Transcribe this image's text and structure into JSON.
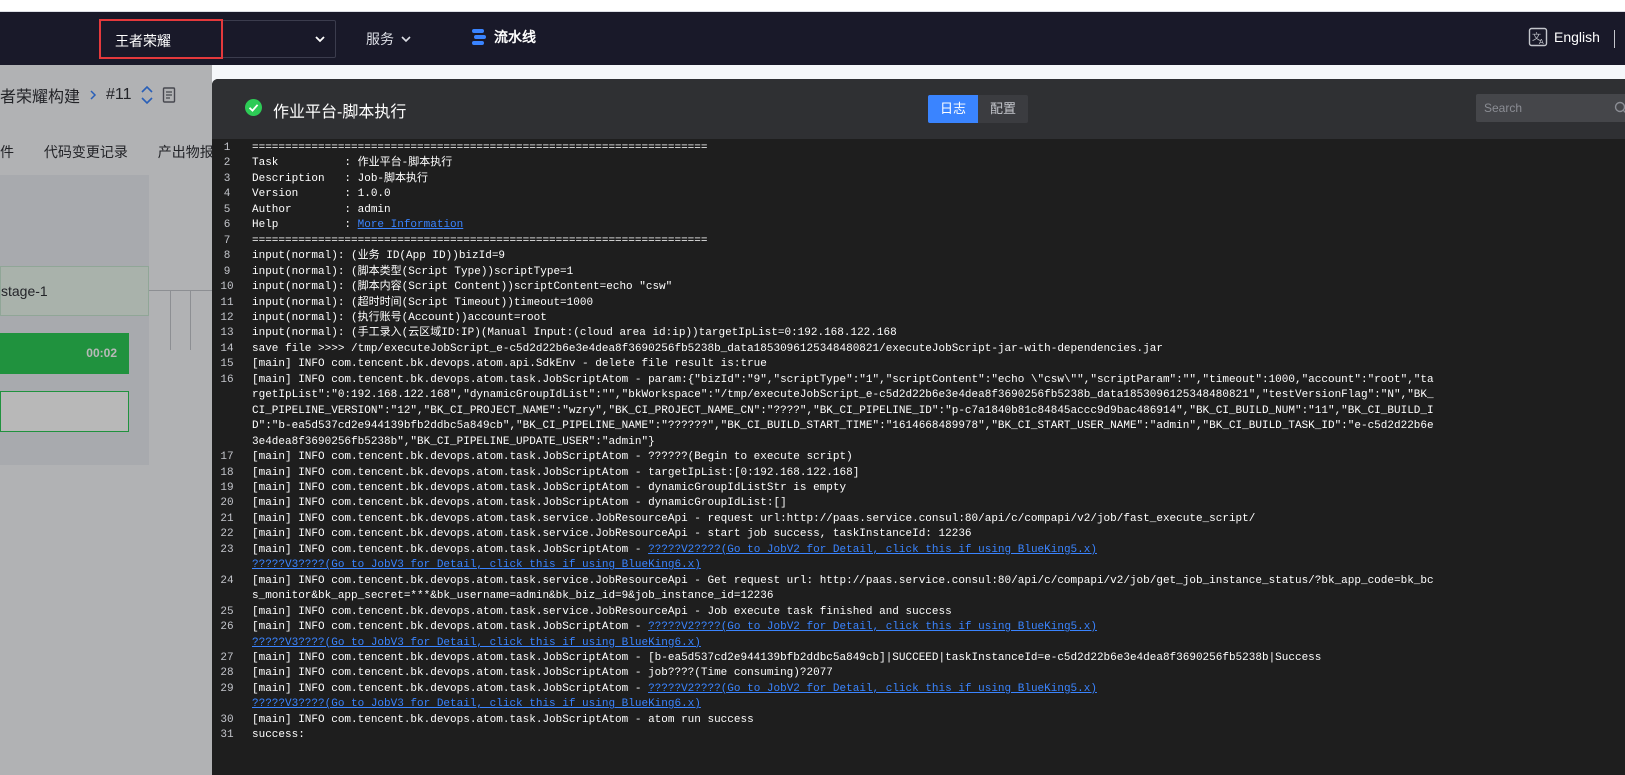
{
  "topnav": {
    "project_name": "王者荣耀",
    "service_label": "服务",
    "pipeline_label": "流水线",
    "language_label": "English"
  },
  "bg": {
    "breadcrumb_name": "者荣耀构建",
    "build_no": "#11",
    "tab_1": "件",
    "tab_2": "代码变更记录",
    "tab_3": "产出物报",
    "stage_label": "stage-1",
    "job_time": "00:02"
  },
  "panel": {
    "title": "作业平台-脚本执行",
    "tab_log": "日志",
    "tab_config": "配置",
    "search_placeholder": "Search",
    "status_color": "#2dcb56"
  },
  "log": [
    {
      "n": "1",
      "text": "====================================================================="
    },
    {
      "n": "2",
      "text": "Task          : 作业平台-脚本执行"
    },
    {
      "n": "3",
      "text": "Description   : Job-脚本执行"
    },
    {
      "n": "4",
      "text": "Version       : 1.0.0"
    },
    {
      "n": "5",
      "text": "Author        : admin"
    },
    {
      "n": "6",
      "text": "Help          : ",
      "link": "More Information"
    },
    {
      "n": "7",
      "text": "====================================================================="
    },
    {
      "n": "8",
      "text": "input(normal): (业务 ID(App ID))bizId=9"
    },
    {
      "n": "9",
      "text": "input(normal): (脚本类型(Script Type))scriptType=1"
    },
    {
      "n": "10",
      "text": "input(normal): (脚本内容(Script Content))scriptContent=echo \"csw\""
    },
    {
      "n": "11",
      "text": "input(normal): (超时时间(Script Timeout))timeout=1000"
    },
    {
      "n": "12",
      "text": "input(normal): (执行账号(Account))account=root"
    },
    {
      "n": "13",
      "text": "input(normal): (手工录入(云区域ID:IP)(Manual Input:(cloud area id:ip))targetIpList=0:192.168.122.168"
    },
    {
      "n": "14",
      "text": "save file >>>> /tmp/executeJobScript_e-c5d2d22b6e3e4dea8f3690256fb5238b_data1853096125348480821/executeJobScript-jar-with-dependencies.jar"
    },
    {
      "n": "15",
      "text": "[main] INFO com.tencent.bk.devops.atom.api.SdkEnv - delete file result is:true"
    },
    {
      "n": "16",
      "text": "[main] INFO com.tencent.bk.devops.atom.task.JobScriptAtom - param:{\"bizId\":\"9\",\"scriptType\":\"1\",\"scriptContent\":\"echo \\\"csw\\\"\",\"scriptParam\":\"\",\"timeout\":1000,\"account\":\"root\",\"targetIpList\":\"0:192.168.122.168\",\"dynamicGroupIdList\":\"\",\"bkWorkspace\":\"/tmp/executeJobScript_e-c5d2d22b6e3e4dea8f3690256fb5238b_data1853096125348480821\",\"testVersionFlag\":\"N\",\"BK_CI_PIPELINE_VERSION\":\"12\",\"BK_CI_PROJECT_NAME\":\"wzry\",\"BK_CI_PROJECT_NAME_CN\":\"????\",\"BK_CI_PIPELINE_ID\":\"p-c7a1840b81c84845accc9d9bac486914\",\"BK_CI_BUILD_NUM\":\"11\",\"BK_CI_BUILD_ID\":\"b-ea5d537cd2e944139bfb2ddbc5a849cb\",\"BK_CI_PIPELINE_NAME\":\"??????\",\"BK_CI_BUILD_START_TIME\":\"1614668489978\",\"BK_CI_START_USER_NAME\":\"admin\",\"BK_CI_BUILD_TASK_ID\":\"e-c5d2d22b6e3e4dea8f3690256fb5238b\",\"BK_CI_PIPELINE_UPDATE_USER\":\"admin\"}"
    },
    {
      "n": "17",
      "text": "[main] INFO com.tencent.bk.devops.atom.task.JobScriptAtom - ??????(Begin to execute script)"
    },
    {
      "n": "18",
      "text": "[main] INFO com.tencent.bk.devops.atom.task.JobScriptAtom - targetIpList:[0:192.168.122.168]"
    },
    {
      "n": "19",
      "text": "[main] INFO com.tencent.bk.devops.atom.task.JobScriptAtom - dynamicGroupIdListStr is empty"
    },
    {
      "n": "20",
      "text": "[main] INFO com.tencent.bk.devops.atom.task.JobScriptAtom - dynamicGroupIdList:[]"
    },
    {
      "n": "21",
      "text": "[main] INFO com.tencent.bk.devops.atom.task.service.JobResourceApi - request url:http://paas.service.consul:80/api/c/compapi/v2/job/fast_execute_script/"
    },
    {
      "n": "22",
      "text": "[main] INFO com.tencent.bk.devops.atom.task.service.JobResourceApi - start job success, taskInstanceId: 12236"
    },
    {
      "n": "23",
      "text": "[main] INFO com.tencent.bk.devops.atom.task.JobScriptAtom - ",
      "link": "?????V2????(Go to JobV2 for Detail, click this if using BlueKing5.x)",
      "link2": "?????V3????(Go to JobV3 for Detail, click this if using BlueKing6.x)"
    },
    {
      "n": "24",
      "text": "[main] INFO com.tencent.bk.devops.atom.task.service.JobResourceApi - Get request url: http://paas.service.consul:80/api/c/compapi/v2/job/get_job_instance_status/?bk_app_code=bk_bcs_monitor&bk_app_secret=***&bk_username=admin&bk_biz_id=9&job_instance_id=12236"
    },
    {
      "n": "25",
      "text": "[main] INFO com.tencent.bk.devops.atom.task.service.JobResourceApi - Job execute task finished and success"
    },
    {
      "n": "26",
      "text": "[main] INFO com.tencent.bk.devops.atom.task.JobScriptAtom - ",
      "link": "?????V2????(Go to JobV2 for Detail, click this if using BlueKing5.x)",
      "link2": "?????V3????(Go to JobV3 for Detail, click this if using BlueKing6.x)"
    },
    {
      "n": "27",
      "text": "[main] INFO com.tencent.bk.devops.atom.task.JobScriptAtom - [b-ea5d537cd2e944139bfb2ddbc5a849cb]|SUCCEED|taskInstanceId=e-c5d2d22b6e3e4dea8f3690256fb5238b|Success"
    },
    {
      "n": "28",
      "text": "[main] INFO com.tencent.bk.devops.atom.task.JobScriptAtom - job????(Time consuming)?2077"
    },
    {
      "n": "29",
      "text": "[main] INFO com.tencent.bk.devops.atom.task.JobScriptAtom - ",
      "link": "?????V2????(Go to JobV2 for Detail, click this if using BlueKing5.x)",
      "link2": "?????V3????(Go to JobV3 for Detail, click this if using BlueKing6.x)"
    },
    {
      "n": "30",
      "text": "[main] INFO com.tencent.bk.devops.atom.task.JobScriptAtom - atom run success"
    },
    {
      "n": "31",
      "text": "success:"
    }
  ]
}
